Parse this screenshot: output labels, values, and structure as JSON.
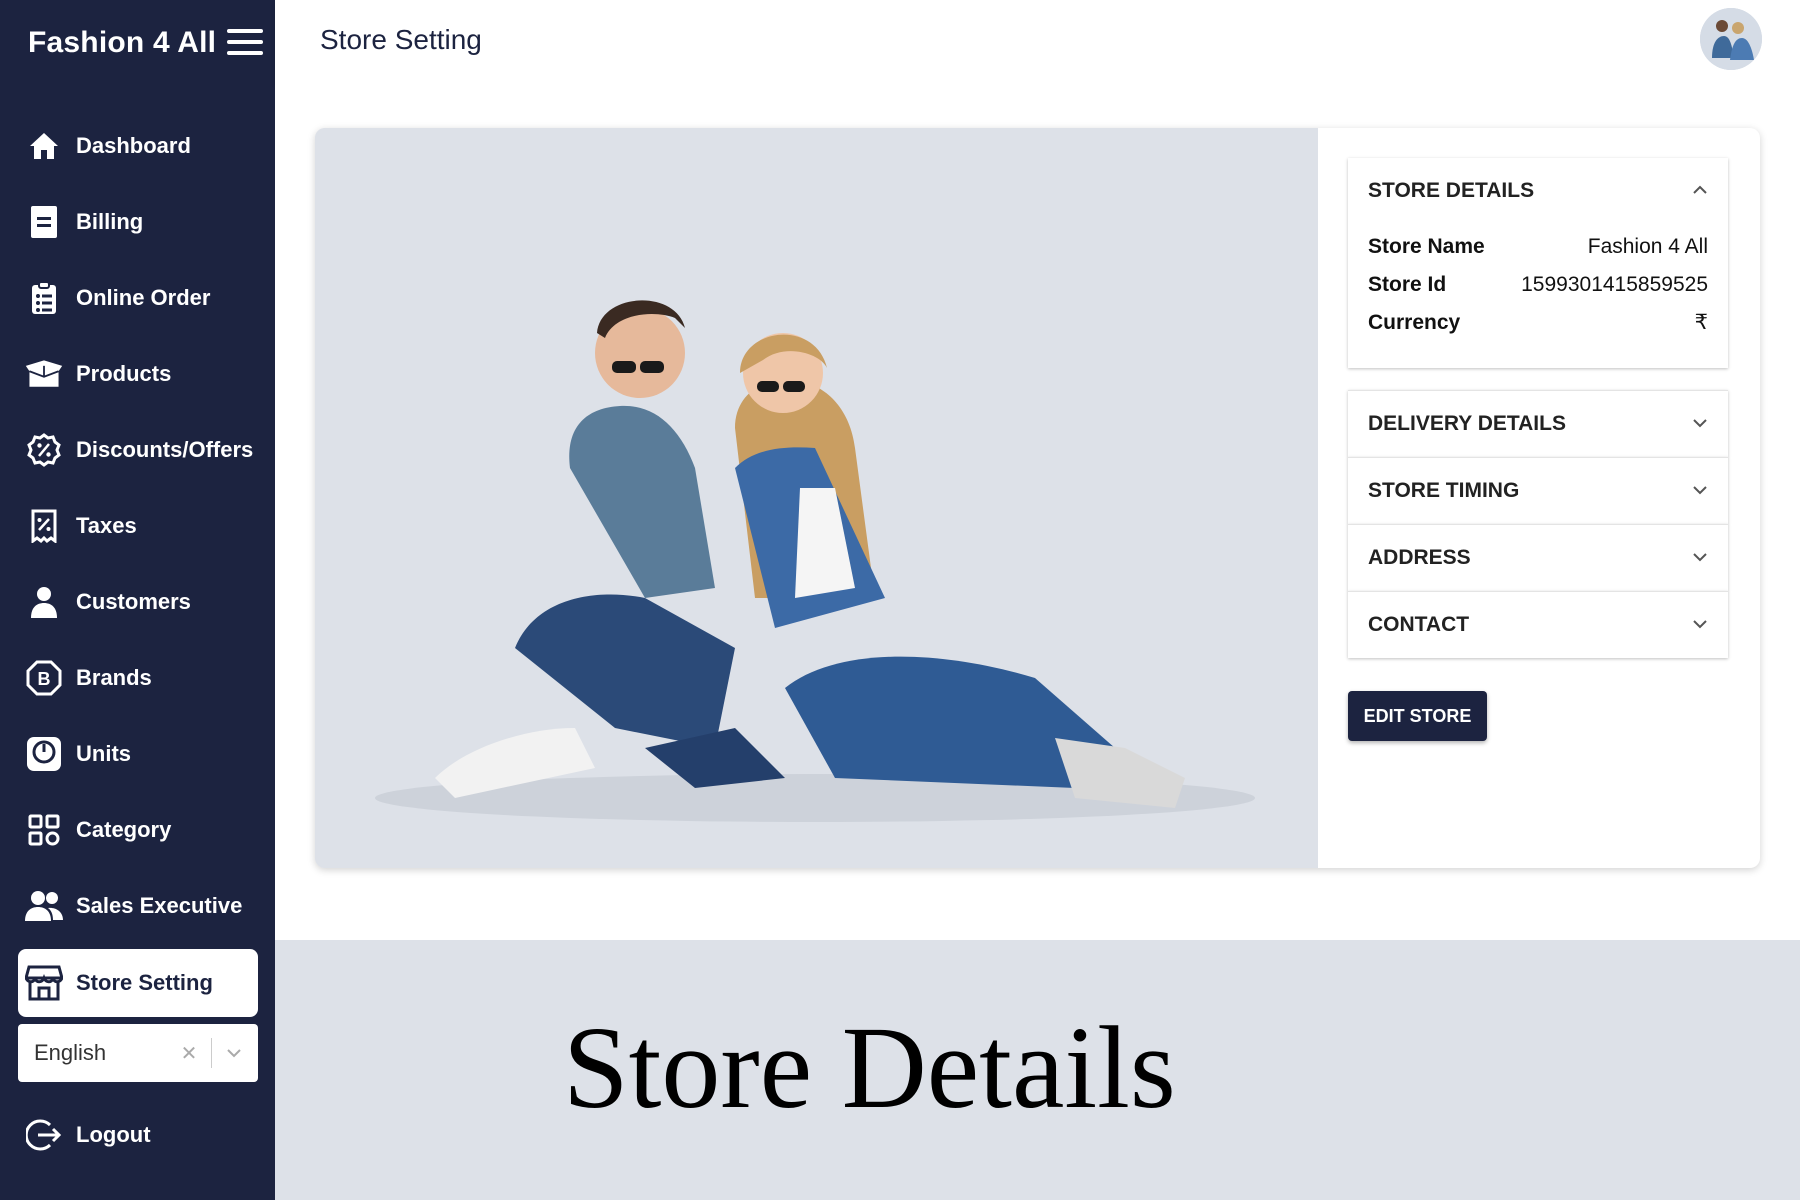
{
  "app": {
    "brand": "Fashion 4 All"
  },
  "sidebar": {
    "items": [
      {
        "label": "Dashboard",
        "icon": "home-icon"
      },
      {
        "label": "Billing",
        "icon": "billing-icon"
      },
      {
        "label": "Online Order",
        "icon": "clipboard-icon"
      },
      {
        "label": "Products",
        "icon": "box-icon"
      },
      {
        "label": "Discounts/Offers",
        "icon": "discount-icon"
      },
      {
        "label": "Taxes",
        "icon": "receipt-icon"
      },
      {
        "label": "Customers",
        "icon": "person-icon"
      },
      {
        "label": "Brands",
        "icon": "brand-icon"
      },
      {
        "label": "Units",
        "icon": "scale-icon"
      },
      {
        "label": "Category",
        "icon": "grid-icon"
      },
      {
        "label": "Sales Executive",
        "icon": "people-icon"
      },
      {
        "label": "Store Setting",
        "icon": "store-icon",
        "active": true
      }
    ],
    "language": {
      "value": "English"
    },
    "logout_label": "Logout"
  },
  "header": {
    "title": "Store Setting"
  },
  "store_panel": {
    "store_details": {
      "title": "STORE DETAILS",
      "expanded": true,
      "rows": [
        {
          "key": "Store Name",
          "value": "Fashion 4 All"
        },
        {
          "key": "Store Id",
          "value": "1599301415859525"
        },
        {
          "key": "Currency",
          "value": "₹"
        }
      ]
    },
    "sections": [
      {
        "title": "DELIVERY DETAILS"
      },
      {
        "title": "STORE TIMING"
      },
      {
        "title": "ADDRESS"
      },
      {
        "title": "CONTACT"
      }
    ],
    "edit_button": "EDIT STORE"
  },
  "caption": "Store Details",
  "colors": {
    "sidebar": "#1c2340",
    "accent": "#1c2340",
    "hero_bg": "#dde1e8"
  }
}
